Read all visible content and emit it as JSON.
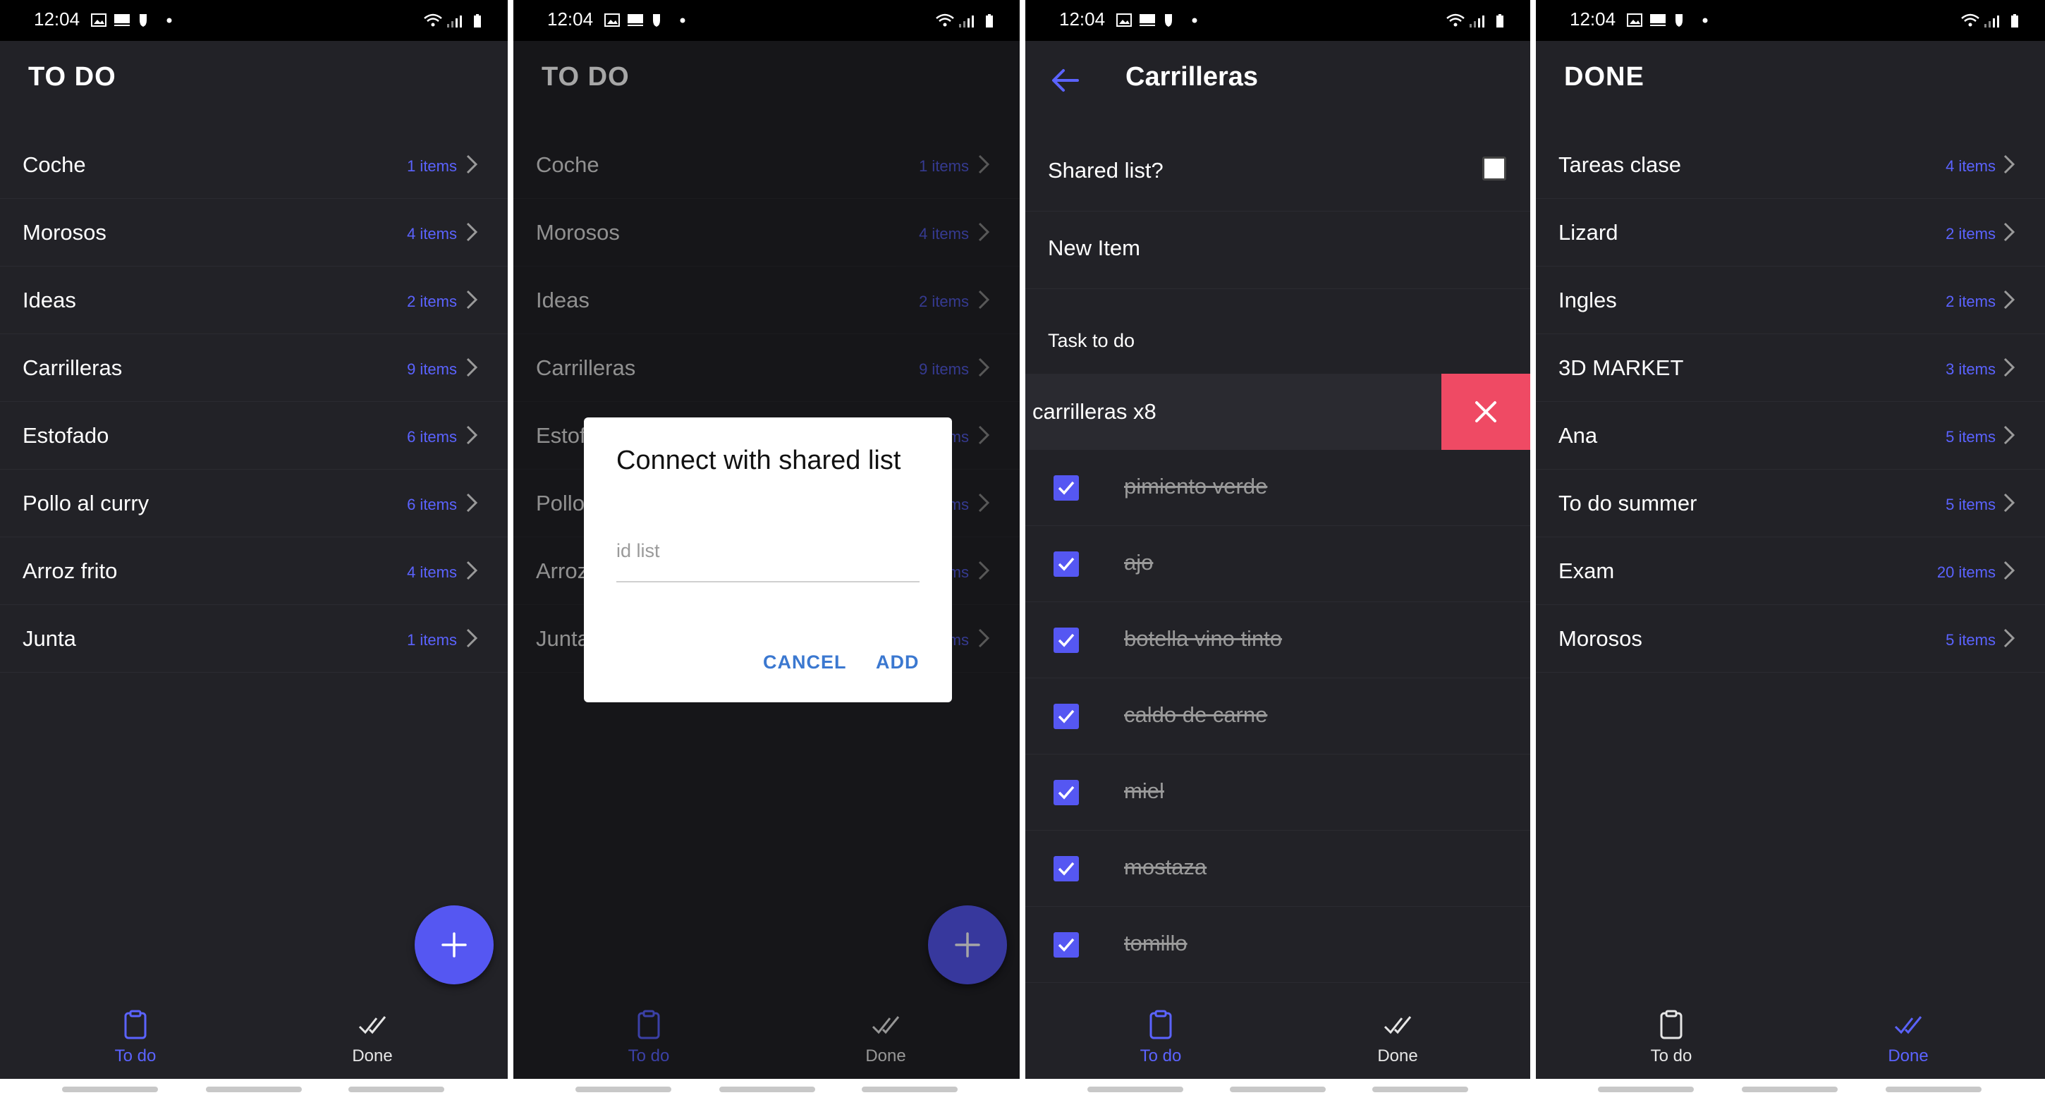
{
  "status_time": "12:04",
  "colors": {
    "background": "#222227",
    "accent": "#5557f2",
    "count_text": "#5b63ff",
    "delete": "#ef4a64",
    "dialog_button": "#3b78d0"
  },
  "nav": {
    "todo_label": "To do",
    "done_label": "Done"
  },
  "screen1": {
    "title": "TO DO",
    "lists": [
      {
        "name": "Coche",
        "count": "1 items"
      },
      {
        "name": "Morosos",
        "count": "4 items"
      },
      {
        "name": "Ideas",
        "count": "2 items"
      },
      {
        "name": "Carrilleras",
        "count": "9 items"
      },
      {
        "name": "Estofado",
        "count": "6 items"
      },
      {
        "name": "Pollo al curry",
        "count": "6 items"
      },
      {
        "name": "Arroz frito",
        "count": "4 items"
      },
      {
        "name": "Junta",
        "count": "1 items"
      }
    ]
  },
  "screen2": {
    "title": "TO DO",
    "dialog": {
      "title": "Connect with shared list",
      "input_placeholder": "id list",
      "cancel_label": "CANCEL",
      "add_label": "ADD"
    }
  },
  "screen3": {
    "title": "Carrilleras",
    "shared_label": "Shared list?",
    "new_item_label": "New Item",
    "task_to_do_label": "Task to do",
    "swiped_item": "carrilleras x8",
    "done_items": [
      "pimiento verde",
      "ajo",
      "botella vino tinto",
      "caldo de carne",
      "miel",
      "mostaza",
      "tomillo"
    ]
  },
  "screen4": {
    "title": "DONE",
    "lists": [
      {
        "name": "Tareas clase",
        "count": "4 items"
      },
      {
        "name": "Lizard",
        "count": "2 items"
      },
      {
        "name": "Ingles",
        "count": "2 items"
      },
      {
        "name": "3D MARKET",
        "count": "3 items"
      },
      {
        "name": "Ana",
        "count": "5 items"
      },
      {
        "name": "To do summer",
        "count": "5 items"
      },
      {
        "name": "Exam",
        "count": "20 items"
      },
      {
        "name": "Morosos",
        "count": "5 items"
      }
    ]
  }
}
